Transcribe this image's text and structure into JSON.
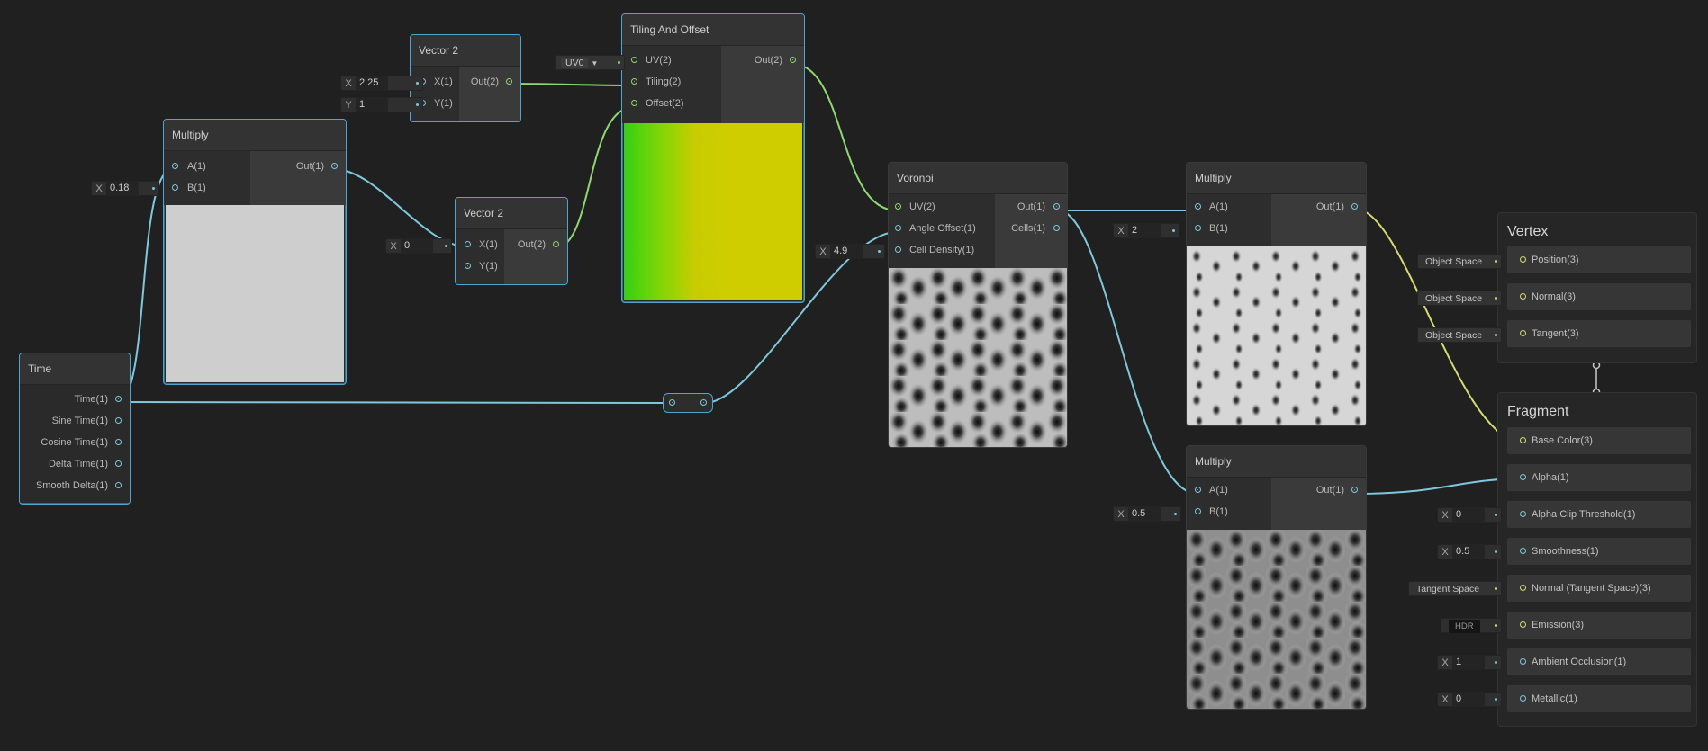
{
  "nodes": {
    "vector2_top": {
      "title": "Vector 2",
      "inputs": [
        "X(1)",
        "Y(1)"
      ],
      "output": "Out(2)",
      "fields": [
        {
          "label": "X",
          "value": "2.25"
        },
        {
          "label": "Y",
          "value": "1"
        }
      ]
    },
    "tiling_offset": {
      "title": "Tiling And Offset",
      "inputs": [
        "UV(2)",
        "Tiling(2)",
        "Offset(2)"
      ],
      "output": "Out(2)",
      "uv_dropdown": "UV0"
    },
    "multiply_left": {
      "title": "Multiply",
      "inputs": [
        "A(1)",
        "B(1)"
      ],
      "output": "Out(1)",
      "field": {
        "label": "X",
        "value": "0.18"
      }
    },
    "vector2_mid": {
      "title": "Vector 2",
      "inputs": [
        "X(1)",
        "Y(1)"
      ],
      "output": "Out(2)",
      "field": {
        "label": "X",
        "value": "0"
      }
    },
    "time": {
      "title": "Time",
      "outputs": [
        "Time(1)",
        "Sine Time(1)",
        "Cosine Time(1)",
        "Delta Time(1)",
        "Smooth Delta(1)"
      ]
    },
    "voronoi": {
      "title": "Voronoi",
      "inputs": [
        "UV(2)",
        "Angle Offset(1)",
        "Cell Density(1)"
      ],
      "outputs": [
        "Out(1)",
        "Cells(1)"
      ],
      "field": {
        "label": "X",
        "value": "4.9"
      }
    },
    "multiply_top_right": {
      "title": "Multiply",
      "inputs": [
        "A(1)",
        "B(1)"
      ],
      "output": "Out(1)",
      "field": {
        "label": "X",
        "value": "2"
      }
    },
    "multiply_bottom_right": {
      "title": "Multiply",
      "inputs": [
        "A(1)",
        "B(1)"
      ],
      "output": "Out(1)",
      "field": {
        "label": "X",
        "value": "0.5"
      }
    }
  },
  "vertex": {
    "title": "Vertex",
    "slots": [
      {
        "label": "Position(3)",
        "space": "Object Space"
      },
      {
        "label": "Normal(3)",
        "space": "Object Space"
      },
      {
        "label": "Tangent(3)",
        "space": "Object Space"
      }
    ]
  },
  "fragment": {
    "title": "Fragment",
    "slots": [
      {
        "label": "Base Color(3)"
      },
      {
        "label": "Alpha(1)"
      },
      {
        "label": "Alpha Clip Threshold(1)",
        "field_label": "X",
        "value": "0"
      },
      {
        "label": "Smoothness(1)",
        "field_label": "X",
        "value": "0.5"
      },
      {
        "label": "Normal (Tangent Space)(3)",
        "space": "Tangent Space"
      },
      {
        "label": "Emission(3)",
        "hdr": "HDR"
      },
      {
        "label": "Ambient Occlusion(1)",
        "field_label": "X",
        "value": "1"
      },
      {
        "label": "Metallic(1)",
        "field_label": "X",
        "value": "0"
      }
    ]
  },
  "colors": {
    "background": "#202020",
    "wire_float": "#7ec8dc",
    "wire_vector2": "#8fd870",
    "wire_vector3": "#d7dc6e",
    "selection": "#4ea6d0"
  }
}
